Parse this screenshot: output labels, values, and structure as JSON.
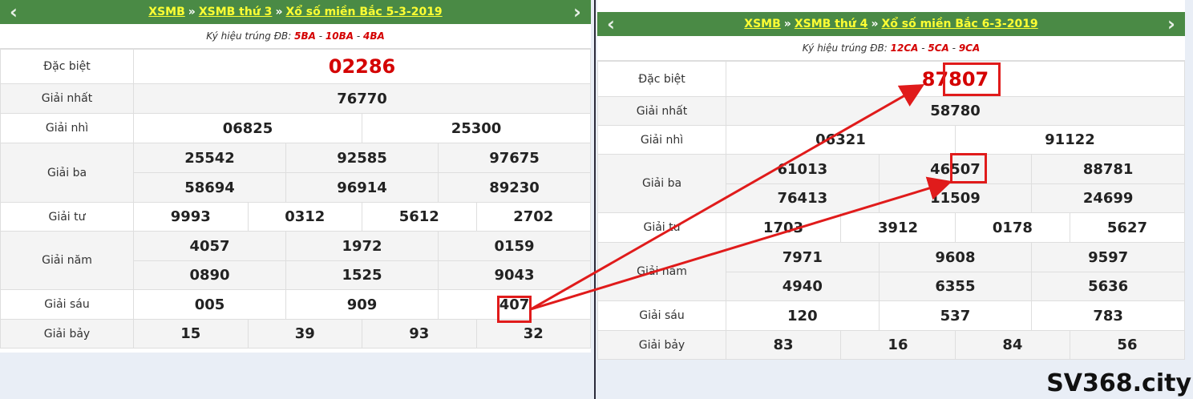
{
  "left": {
    "breadcrumb": [
      "XSMB",
      "XSMB thứ 3",
      "Xổ số miền Bắc 5-3-2019"
    ],
    "sep": "»",
    "nav_prev": "‹",
    "nav_next": "›",
    "kyhieu_label": "Ký hiệu trúng ĐB:",
    "kyhieu_codes": [
      "5BA",
      "10BA",
      "4BA"
    ],
    "prizes": {
      "db": {
        "label": "Đặc biệt",
        "nums": [
          "02286"
        ]
      },
      "g1": {
        "label": "Giải nhất",
        "nums": [
          "76770"
        ]
      },
      "g2": {
        "label": "Giải nhì",
        "nums": [
          "06825",
          "25300"
        ]
      },
      "g3": {
        "label": "Giải ba",
        "nums": [
          "25542",
          "92585",
          "97675",
          "58694",
          "96914",
          "89230"
        ]
      },
      "g4": {
        "label": "Giải tư",
        "nums": [
          "9993",
          "0312",
          "5612",
          "2702"
        ]
      },
      "g5": {
        "label": "Giải năm",
        "nums": [
          "4057",
          "1972",
          "0159",
          "0890",
          "1525",
          "9043"
        ]
      },
      "g6": {
        "label": "Giải sáu",
        "nums": [
          "005",
          "909",
          "407"
        ]
      },
      "g7": {
        "label": "Giải bảy",
        "nums": [
          "15",
          "39",
          "93",
          "32"
        ]
      }
    }
  },
  "right": {
    "breadcrumb": [
      "XSMB",
      "XSMB thứ 4",
      "Xổ số miền Bắc 6-3-2019"
    ],
    "sep": "»",
    "nav_prev": "‹",
    "nav_next": "›",
    "kyhieu_label": "Ký hiệu trúng ĐB:",
    "kyhieu_codes": [
      "12CA",
      "5CA",
      "9CA"
    ],
    "prizes": {
      "db": {
        "label": "Đặc biệt",
        "nums": [
          "87807"
        ]
      },
      "g1": {
        "label": "Giải nhất",
        "nums": [
          "58780"
        ]
      },
      "g2": {
        "label": "Giải nhì",
        "nums": [
          "06321",
          "91122"
        ]
      },
      "g3": {
        "label": "Giải ba",
        "nums": [
          "61013",
          "46507",
          "88781",
          "76413",
          "11509",
          "24699"
        ]
      },
      "g4": {
        "label": "Giải tư",
        "nums": [
          "1703",
          "3912",
          "0178",
          "5627"
        ]
      },
      "g5": {
        "label": "Giải năm",
        "nums": [
          "7971",
          "9608",
          "9597",
          "4940",
          "6355",
          "5636"
        ]
      },
      "g6": {
        "label": "Giải sáu",
        "nums": [
          "120",
          "537",
          "783"
        ]
      },
      "g7": {
        "label": "Giải bảy",
        "nums": [
          "83",
          "16",
          "84",
          "56"
        ]
      }
    }
  },
  "watermark": "SV368.city",
  "colors": {
    "header_bg": "#4a8a45",
    "header_text": "#ffff33",
    "special": "#d40000",
    "highlight": "#e01b1b"
  }
}
